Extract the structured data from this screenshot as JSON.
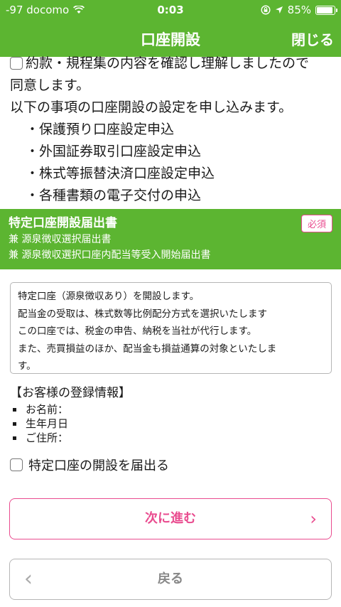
{
  "status": {
    "carrier": "-97 docomo",
    "time": "0:03",
    "battery_percent": "85%",
    "battery_level": 0.85,
    "icons": [
      "wifi-icon",
      "orientation-lock-icon",
      "location-arrow-icon",
      "battery-icon"
    ]
  },
  "nav": {
    "title": "口座開設",
    "close_label": "閉じる"
  },
  "agreement": {
    "line1": "約款・規程集の内容を確認し理解しましたので",
    "line2": "同意します。",
    "line3": "以下の事項の口座開設の設定を申し込みます。",
    "items": [
      "保護預り口座設定申込",
      "外国証券取引口座設定申込",
      "株式等振替決済口座設定申込",
      "各種書類の電子交付の申込"
    ]
  },
  "band": {
    "title": "特定口座開設届出書",
    "badge": "必須",
    "sub1": "兼 源泉徴収選択届出書",
    "sub2": "兼 源泉徴収選択口座内配当等受入開始届出書"
  },
  "notice": {
    "lines": [
      "特定口座（源泉徴収あり）を開設します。",
      "配当金の受取は、株式数等比例配分方式を選択いたします",
      "この口座では、税金の申告、納税を当社が代行します。",
      "また、売買損益のほか、配当金も損益通算の対象といたしま",
      "す。"
    ]
  },
  "registration": {
    "heading": "【お客様の登録情報】",
    "name_label": "お名前：",
    "birth_label": "生年月日",
    "address_label": "ご住所："
  },
  "checkbox": {
    "label": "特定口座の開設を届出る"
  },
  "buttons": {
    "next": "次に進む",
    "back": "戻る"
  },
  "colors": {
    "brand_green": "#5cb531",
    "accent_pink": "#e94c8f"
  }
}
